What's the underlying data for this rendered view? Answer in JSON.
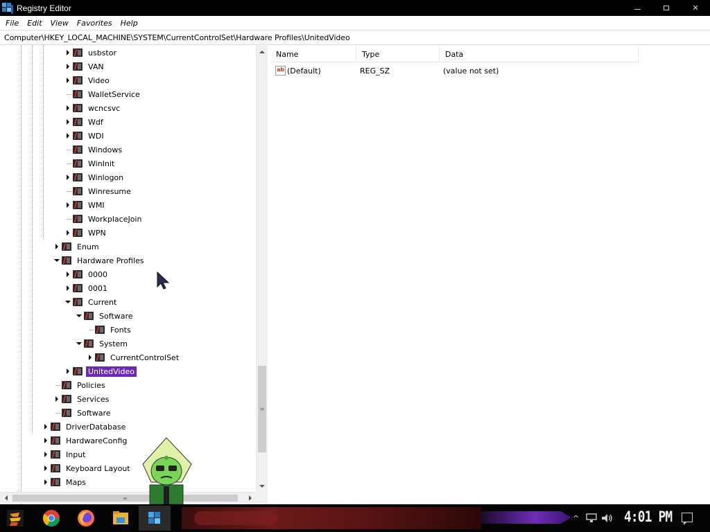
{
  "window": {
    "title": "Registry Editor",
    "controls": {
      "minimize": "",
      "maximize": "",
      "close": "✕"
    }
  },
  "menu": [
    "File",
    "Edit",
    "View",
    "Favorites",
    "Help"
  ],
  "address": "Computer\\HKEY_LOCAL_MACHINE\\SYSTEM\\CurrentControlSet\\Hardware Profiles\\UnitedVideo",
  "tree": [
    {
      "label": "usbstor",
      "expander": "collapsed"
    },
    {
      "label": "VAN",
      "expander": "collapsed"
    },
    {
      "label": "Video",
      "expander": "collapsed"
    },
    {
      "label": "WalletService",
      "expander": "none"
    },
    {
      "label": "wcncsvc",
      "expander": "collapsed"
    },
    {
      "label": "Wdf",
      "expander": "collapsed"
    },
    {
      "label": "WDI",
      "expander": "collapsed"
    },
    {
      "label": "Windows",
      "expander": "none"
    },
    {
      "label": "WinInit",
      "expander": "none"
    },
    {
      "label": "Winlogon",
      "expander": "collapsed"
    },
    {
      "label": "Winresume",
      "expander": "none"
    },
    {
      "label": "WMI",
      "expander": "collapsed"
    },
    {
      "label": "WorkplaceJoin",
      "expander": "none"
    },
    {
      "label": "WPN",
      "expander": "collapsed"
    },
    {
      "label": "Enum",
      "expander": "collapsed"
    },
    {
      "label": "Hardware Profiles",
      "expander": "expanded"
    },
    {
      "label": "0000",
      "expander": "collapsed"
    },
    {
      "label": "0001",
      "expander": "collapsed"
    },
    {
      "label": "Current",
      "expander": "expanded"
    },
    {
      "label": "Software",
      "expander": "expanded"
    },
    {
      "label": "Fonts",
      "expander": "none"
    },
    {
      "label": "System",
      "expander": "expanded"
    },
    {
      "label": "CurrentControlSet",
      "expander": "collapsed"
    },
    {
      "label": "UnitedVideo",
      "expander": "collapsed",
      "selected": true
    },
    {
      "label": "Policies",
      "expander": "none"
    },
    {
      "label": "Services",
      "expander": "collapsed"
    },
    {
      "label": "Software",
      "expander": "none"
    },
    {
      "label": "DriverDatabase",
      "expander": "collapsed"
    },
    {
      "label": "HardwareConfig",
      "expander": "collapsed"
    },
    {
      "label": "Input",
      "expander": "collapsed"
    },
    {
      "label": "Keyboard Layout",
      "expander": "collapsed"
    },
    {
      "label": "Maps",
      "expander": "collapsed"
    }
  ],
  "values": {
    "columns": [
      "Name",
      "Type",
      "Data"
    ],
    "rows": [
      {
        "name": "(Default)",
        "type": "REG_SZ",
        "data": "(value not set)",
        "icon": "string-value-icon",
        "icon_text": "ab"
      }
    ]
  },
  "scrollbar": {
    "grip": "≡"
  },
  "taskbar": {
    "apps": [
      "start-button",
      "chrome-icon",
      "firefox-icon",
      "file-explorer-icon",
      "registry-editor-icon"
    ],
    "tray": {
      "chevron": "^",
      "clock": "4:01 PM"
    }
  },
  "colors": {
    "selection": "#6d28b8",
    "titlebar": "#000000",
    "taskbar": "#050505",
    "accent_purple": "#6e2db8"
  }
}
